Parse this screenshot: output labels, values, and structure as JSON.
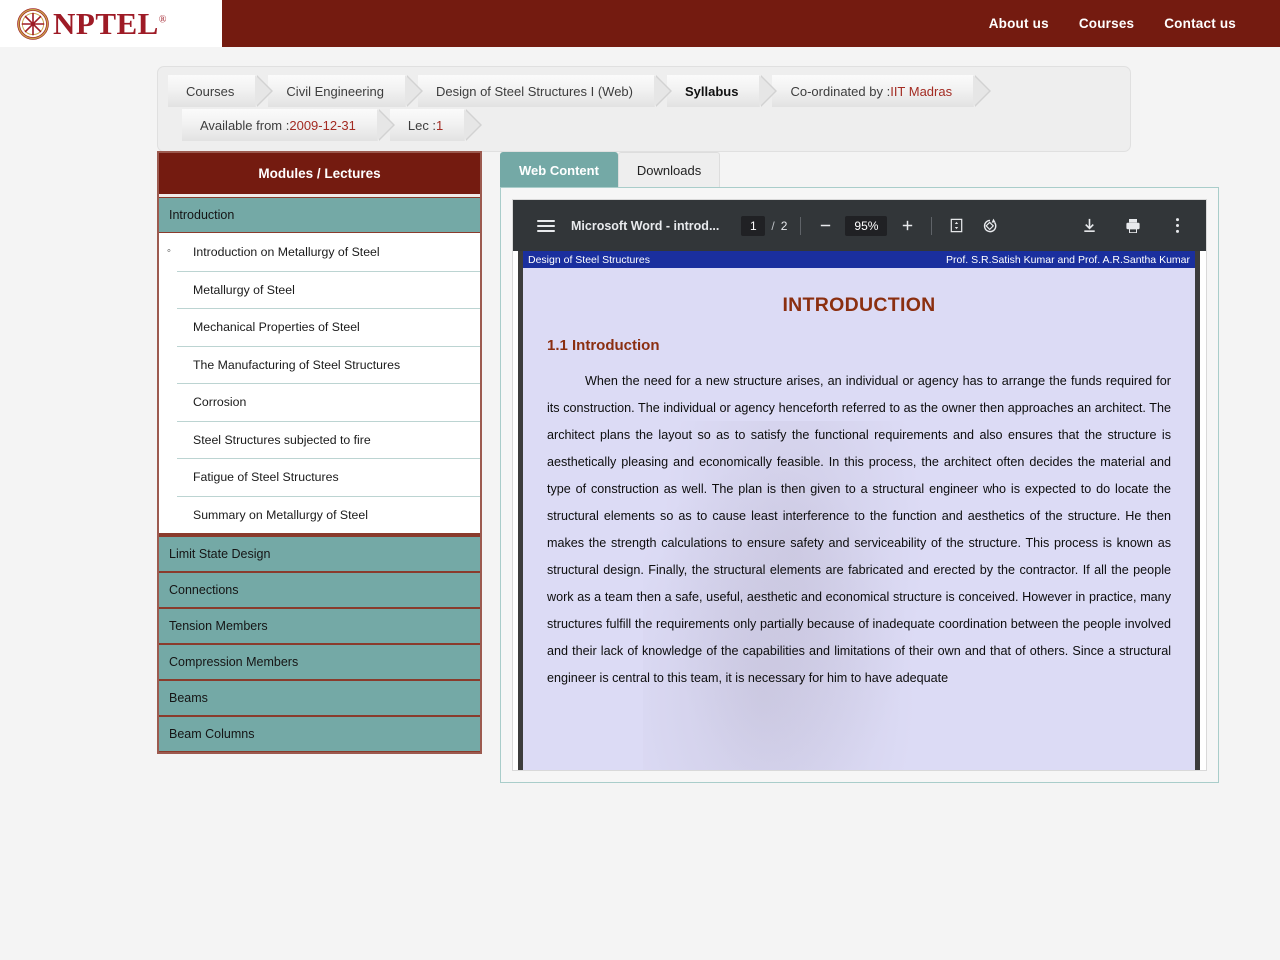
{
  "site": {
    "logo_text": "NPTEL",
    "logo_registered": "®",
    "nav": [
      {
        "label": "About us"
      },
      {
        "label": "Courses"
      },
      {
        "label": "Contact us"
      }
    ]
  },
  "breadcrumb": {
    "row1": [
      {
        "label": "Courses",
        "active": false
      },
      {
        "label": "Civil Engineering",
        "active": false
      },
      {
        "label": "Design of Steel Structures I (Web)",
        "active": false
      },
      {
        "label": "Syllabus",
        "active": true
      },
      {
        "prefix": "Co-ordinated by : ",
        "highlight": "IIT Madras",
        "active": false
      }
    ],
    "row2": [
      {
        "prefix": "Available from : ",
        "highlight": "2009-12-31"
      },
      {
        "prefix": "Lec :",
        "highlight": "1"
      }
    ]
  },
  "sidebar": {
    "header": "Modules / Lectures",
    "modules": [
      {
        "label": "Introduction",
        "expanded": true,
        "lectures": [
          {
            "label": "Introduction on Metallurgy of Steel",
            "selected": true
          },
          {
            "label": "Metallurgy of Steel",
            "selected": false
          },
          {
            "label": "Mechanical Properties of Steel",
            "selected": false
          },
          {
            "label": "The Manufacturing of Steel Structures",
            "selected": false
          },
          {
            "label": "Corrosion",
            "selected": false
          },
          {
            "label": "Steel Structures subjected to fire",
            "selected": false
          },
          {
            "label": "Fatigue of Steel Structures",
            "selected": false
          },
          {
            "label": "Summary on Metallurgy of Steel",
            "selected": false
          }
        ]
      },
      {
        "label": "Limit State Design",
        "expanded": false,
        "lectures": []
      },
      {
        "label": "Connections",
        "expanded": false,
        "lectures": []
      },
      {
        "label": "Tension Members",
        "expanded": false,
        "lectures": []
      },
      {
        "label": "Compression Members",
        "expanded": false,
        "lectures": []
      },
      {
        "label": "Beams",
        "expanded": false,
        "lectures": []
      },
      {
        "label": "Beam Columns",
        "expanded": false,
        "lectures": []
      }
    ]
  },
  "content_tabs": [
    {
      "label": "Web Content",
      "active": true
    },
    {
      "label": "Downloads",
      "active": false
    }
  ],
  "pdf_viewer": {
    "title": "Microsoft Word - introd...",
    "page_current": "1",
    "page_separator": "/",
    "page_total": "2",
    "zoom": "95%",
    "buttons": {
      "menu": "☰",
      "zoom_out": "−",
      "zoom_in": "+",
      "fit_page": "fit-page",
      "rotate": "rotate",
      "download": "download",
      "print": "print",
      "more": "more-options"
    }
  },
  "document": {
    "header_left": "Design of Steel Structures",
    "header_right": "Prof. S.R.Satish Kumar and Prof. A.R.Santha Kumar",
    "title": "INTRODUCTION",
    "section_heading": "1.1 Introduction",
    "paragraph": "When the need for a new structure arises, an individual or agency has to arrange the funds required for its construction. The individual or agency henceforth referred to as the owner then approaches an architect. The architect plans the layout so as to satisfy the functional requirements and also ensures that the structure is aesthetically pleasing and economically feasible. In this process, the architect often decides the material and type of construction as well. The plan is then given to a structural engineer who is expected to do locate the structural elements so as to cause least interference to the function and aesthetics of the structure. He then makes the strength calculations to ensure safety and serviceability of the structure. This process is known as structural design. Finally, the structural elements are fabricated and erected by the contractor. If all the people work as a team then a safe, useful, aesthetic and economical structure is conceived. However in practice, many structures fulfill the requirements only partially because of inadequate coordination between the people involved and their lack of knowledge of the capabilities and limitations of their own and that of others. Since a structural engineer is central to this team, it is necessary for him to have adequate"
  },
  "colors": {
    "brand_maroon": "#741b10",
    "teal": "#74a9a6",
    "accent_red": "#a32b22",
    "pdf_toolbar": "#323639",
    "page_band_blue": "#1a2f9e",
    "doc_heading": "#8b2f10",
    "page_bg": "#dcdbf5"
  }
}
